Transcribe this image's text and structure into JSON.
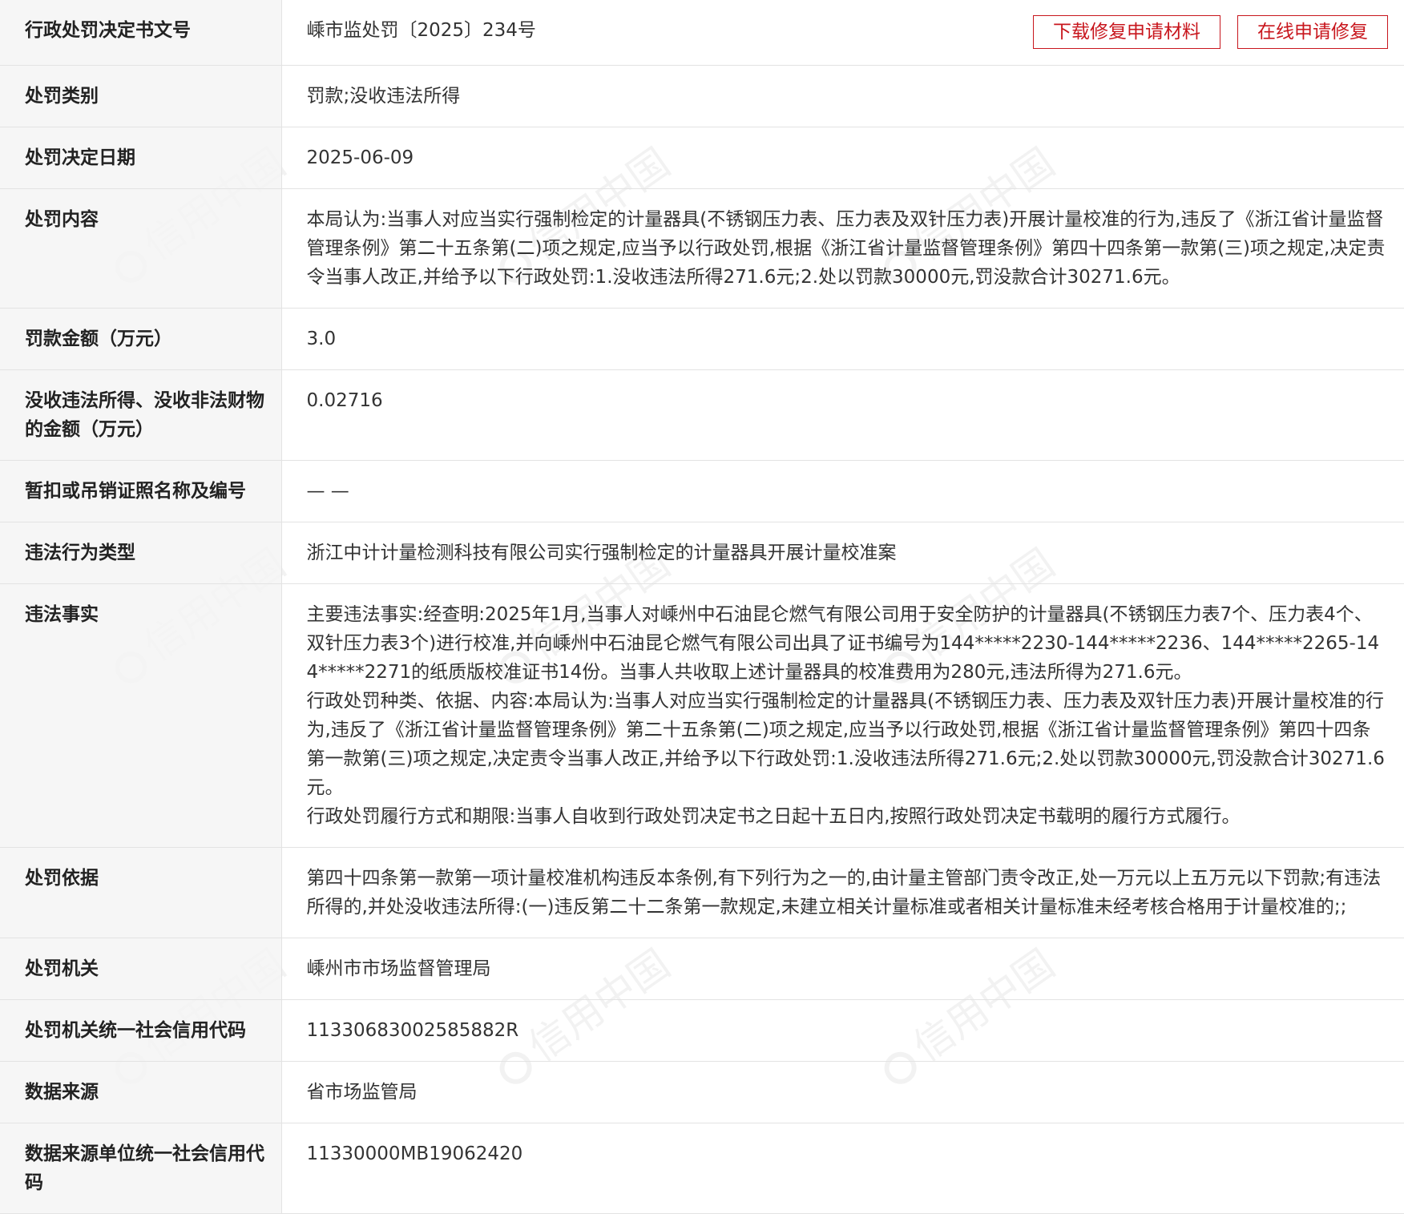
{
  "buttons": {
    "download": "下载修复申请材料",
    "online_repair": "在线申请修复"
  },
  "watermark": {
    "text": "信用中国"
  },
  "fields": {
    "doc_number": {
      "label": "行政处罚决定书文号",
      "value": "嵊市监处罚〔2025〕234号"
    },
    "penalty_type": {
      "label": "处罚类别",
      "value": "罚款;没收违法所得"
    },
    "decision_date": {
      "label": "处罚决定日期",
      "value": "2025-06-09"
    },
    "penalty_content": {
      "label": "处罚内容",
      "value": "本局认为:当事人对应当实行强制检定的计量器具(不锈钢压力表、压力表及双针压力表)开展计量校准的行为,违反了《浙江省计量监督管理条例》第二十五条第(二)项之规定,应当予以行政处罚,根据《浙江省计量监督管理条例》第四十四条第一款第(三)项之规定,决定责令当事人改正,并给予以下行政处罚:1.没收违法所得271.6元;2.处以罚款30000元,罚没款合计30271.6元。"
    },
    "fine_amount": {
      "label": "罚款金额（万元）",
      "value": "3.0"
    },
    "confiscation_amount": {
      "label": "没收违法所得、没收非法财物的金额（万元）",
      "value": "0.02716"
    },
    "license_suspension": {
      "label": "暂扣或吊销证照名称及编号",
      "value": "— —"
    },
    "violation_type": {
      "label": "违法行为类型",
      "value": "浙江中计计量检测科技有限公司实行强制检定的计量器具开展计量校准案"
    },
    "violation_facts": {
      "label": "违法事实",
      "p1": "主要违法事实:经查明:2025年1月,当事人对嵊州中石油昆仑燃气有限公司用于安全防护的计量器具(不锈钢压力表7个、压力表4个、双针压力表3个)进行校准,并向嵊州中石油昆仑燃气有限公司出具了证书编号为144*****2230-144*****2236、144*****2265-144*****2271的纸质版校准证书14份。当事人共收取上述计量器具的校准费用为280元,违法所得为271.6元。",
      "p2": "行政处罚种类、依据、内容:本局认为:当事人对应当实行强制检定的计量器具(不锈钢压力表、压力表及双针压力表)开展计量校准的行为,违反了《浙江省计量监督管理条例》第二十五条第(二)项之规定,应当予以行政处罚,根据《浙江省计量监督管理条例》第四十四条第一款第(三)项之规定,决定责令当事人改正,并给予以下行政处罚:1.没收违法所得271.6元;2.处以罚款30000元,罚没款合计30271.6元。",
      "p3": "行政处罚履行方式和期限:当事人自收到行政处罚决定书之日起十五日内,按照行政处罚决定书载明的履行方式履行。"
    },
    "penalty_basis": {
      "label": "处罚依据",
      "value": "第四十四条第一款第一项计量校准机构违反本条例,有下列行为之一的,由计量主管部门责令改正,处一万元以上五万元以下罚款;有违法所得的,并处没收违法所得:(一)违反第二十二条第一款规定,未建立相关计量标准或者相关计量标准未经考核合格用于计量校准的;;"
    },
    "authority": {
      "label": "处罚机关",
      "value": "嵊州市市场监督管理局"
    },
    "authority_code": {
      "label": "处罚机关统一社会信用代码",
      "value": "11330683002585882R"
    },
    "data_source": {
      "label": "数据来源",
      "value": "省市场监管局"
    },
    "data_source_code": {
      "label": "数据来源单位统一社会信用代码",
      "value": "11330000MB19062420"
    }
  }
}
